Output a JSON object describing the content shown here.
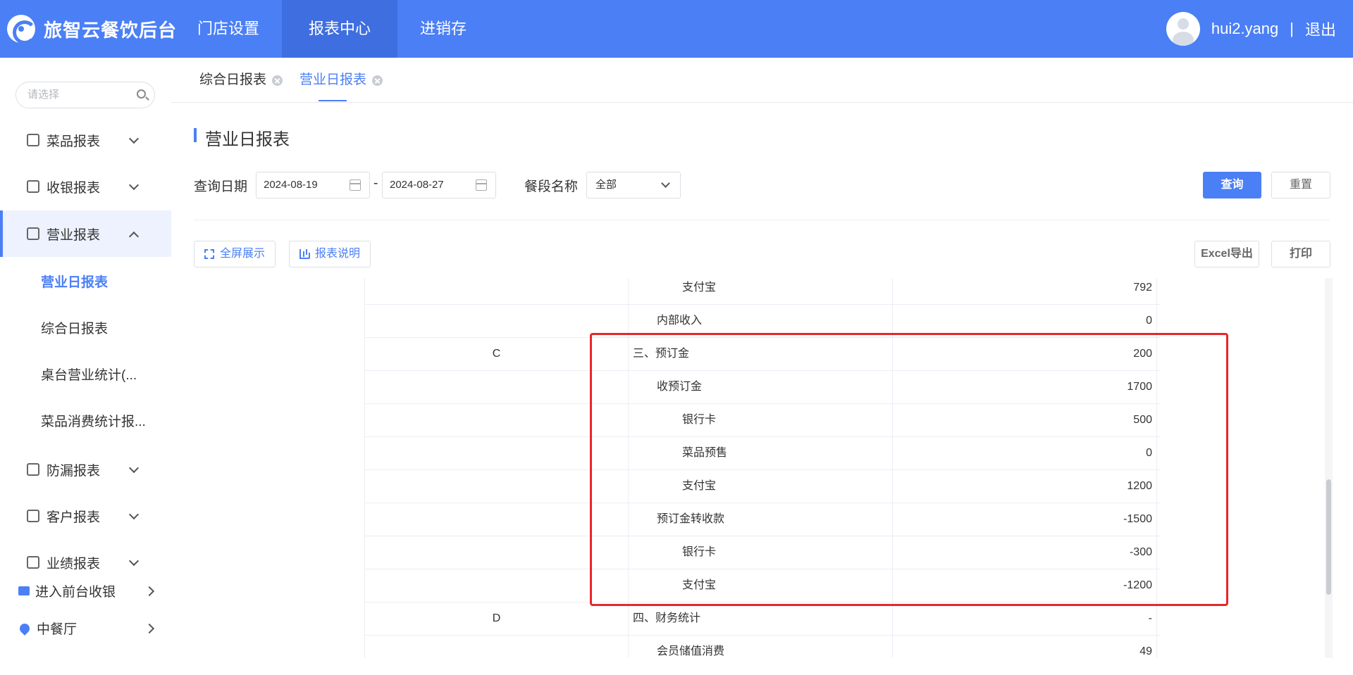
{
  "app": {
    "title": "旅智云餐饮后台"
  },
  "topnav": [
    {
      "label": "门店设置",
      "active": false
    },
    {
      "label": "报表中心",
      "active": true
    },
    {
      "label": "进销存",
      "active": false
    }
  ],
  "user": {
    "name": "hui2.yang",
    "separator": "|",
    "logout": "退出"
  },
  "sidebar": {
    "search_placeholder": "请选择",
    "menus": [
      {
        "label": "菜品报表",
        "icon": "chart-icon",
        "open": false
      },
      {
        "label": "收银报表",
        "icon": "cashier-icon",
        "open": false
      },
      {
        "label": "营业报表",
        "icon": "business-icon",
        "open": true
      },
      {
        "label": "防漏报表",
        "icon": "shield-icon",
        "open": false
      },
      {
        "label": "客户报表",
        "icon": "customer-icon",
        "open": false
      },
      {
        "label": "业绩报表",
        "icon": "performance-icon",
        "open": false
      }
    ],
    "subitems": [
      {
        "label": "营业日报表",
        "active": true
      },
      {
        "label": "综合日报表",
        "active": false
      },
      {
        "label": "桌台营业统计(...",
        "active": false
      },
      {
        "label": "菜品消费统计报...",
        "active": false
      }
    ],
    "bottom": [
      {
        "label": "进入前台收银"
      },
      {
        "label": "中餐厅"
      }
    ]
  },
  "tabs": [
    {
      "label": "综合日报表",
      "active": false
    },
    {
      "label": "营业日报表",
      "active": true
    }
  ],
  "page": {
    "title": "营业日报表",
    "filters": {
      "date_label": "查询日期",
      "date_start": "2024-08-19",
      "date_sep": "-",
      "date_end": "2024-08-27",
      "meal_label": "餐段名称",
      "meal_value": "全部"
    },
    "buttons": {
      "query": "查询",
      "reset": "重置",
      "fullscreen": "全屏展示",
      "explain": "报表说明",
      "excel": "Excel导出",
      "print": "打印"
    }
  },
  "table": {
    "rows": [
      {
        "code": "",
        "name": "支付宝",
        "level": 3,
        "value": "792"
      },
      {
        "code": "",
        "name": "内部收入",
        "level": 2,
        "value": "0"
      },
      {
        "code": "C",
        "name": "三、预订金",
        "level": 1,
        "value": "200"
      },
      {
        "code": "",
        "name": "收预订金",
        "level": 2,
        "value": "1700"
      },
      {
        "code": "",
        "name": "银行卡",
        "level": 3,
        "value": "500"
      },
      {
        "code": "",
        "name": "菜品预售",
        "level": 3,
        "value": "0"
      },
      {
        "code": "",
        "name": "支付宝",
        "level": 3,
        "value": "1200"
      },
      {
        "code": "",
        "name": "预订金转收款",
        "level": 2,
        "value": "-1500"
      },
      {
        "code": "",
        "name": "银行卡",
        "level": 3,
        "value": "-300"
      },
      {
        "code": "",
        "name": "支付宝",
        "level": 3,
        "value": "-1200"
      },
      {
        "code": "D",
        "name": "四、财务统计",
        "level": 1,
        "value": "-"
      },
      {
        "code": "",
        "name": "会员储值消费",
        "level": 2,
        "value": "49"
      }
    ]
  },
  "colors": {
    "primary": "#4b7ff5",
    "highlight": "#e8262a"
  }
}
